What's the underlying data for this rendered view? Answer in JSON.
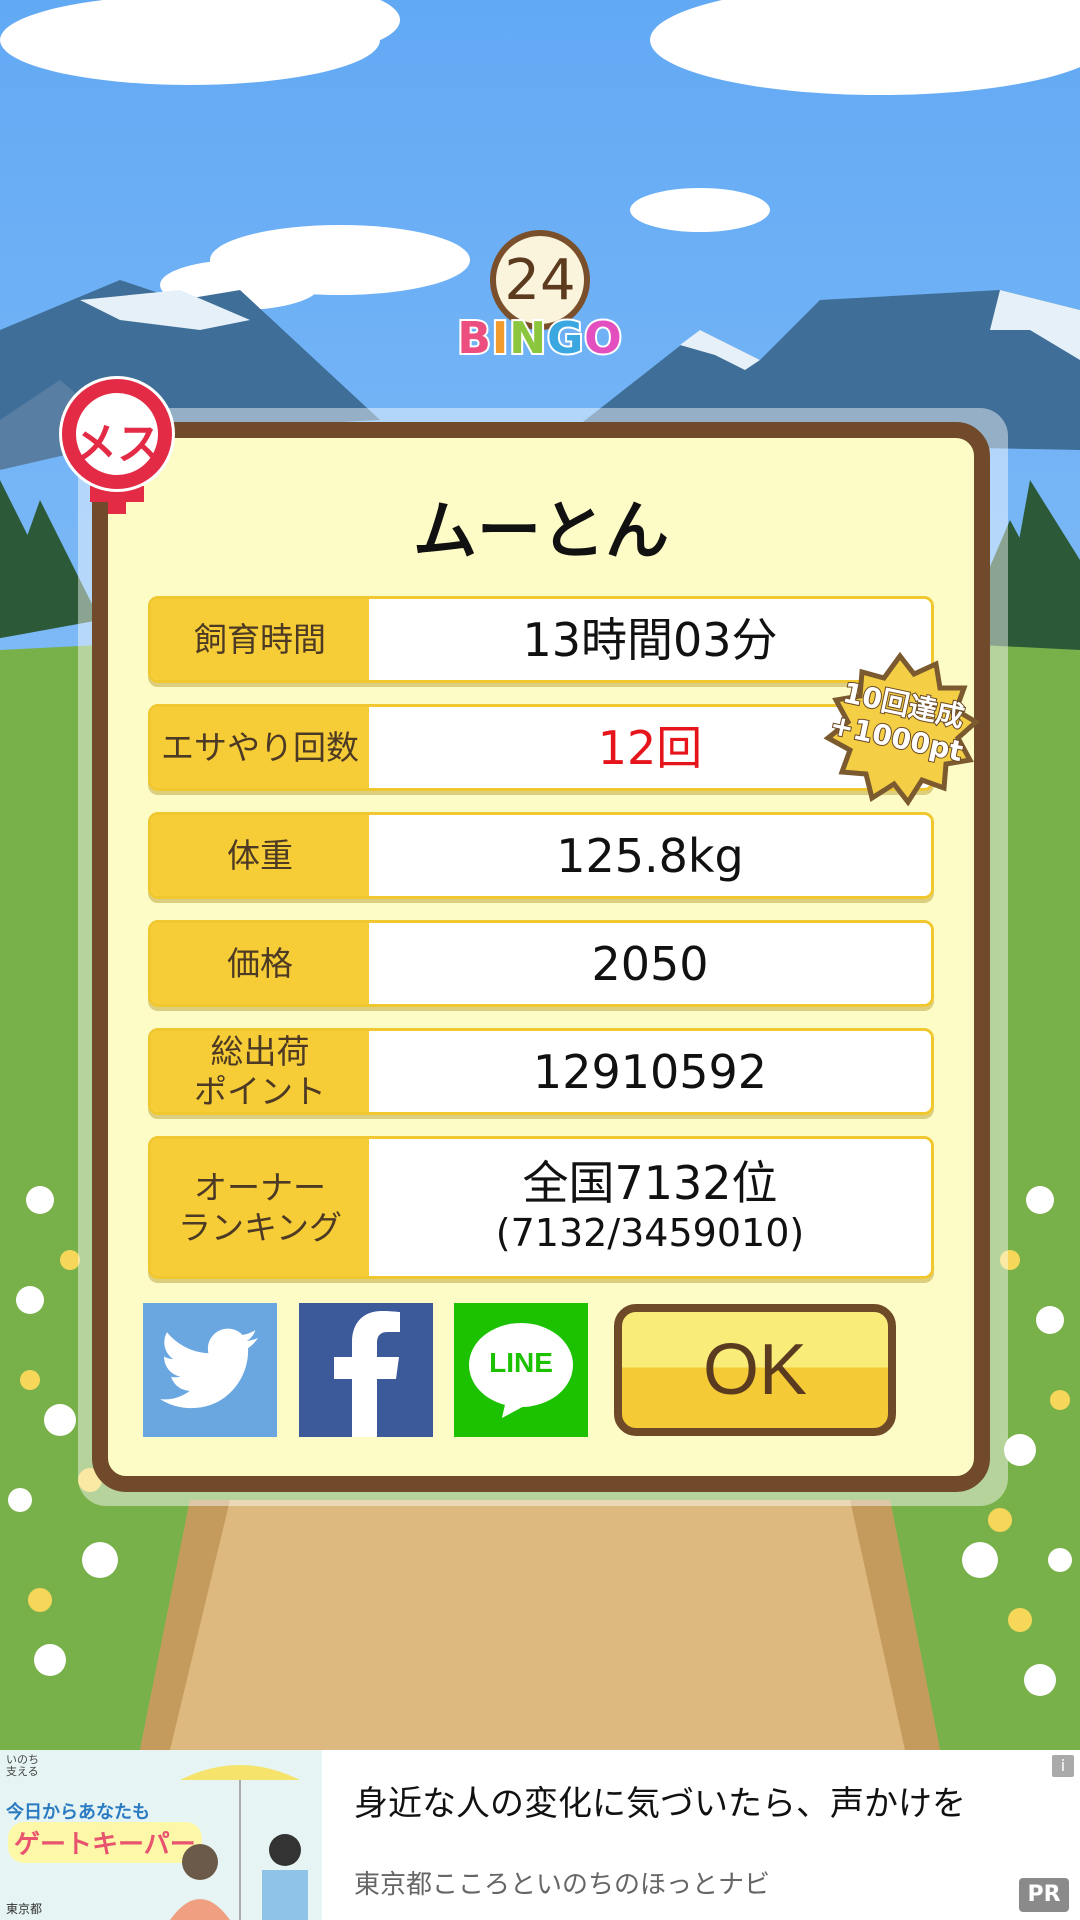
{
  "bingo": {
    "number": "24",
    "letters": [
      "B",
      "I",
      "N",
      "G",
      "O"
    ],
    "letter_colors": [
      "#ec4f7f",
      "#f39c2e",
      "#8cc63f",
      "#3aa7e0",
      "#e44fbf"
    ]
  },
  "gender": {
    "label": "メス",
    "color": "#e32b46"
  },
  "pig": {
    "name": "ムーとん"
  },
  "stats": {
    "rows": [
      {
        "label": "飼育時間",
        "value": "13時間03分"
      },
      {
        "label": "エサやり回数",
        "value": "12回"
      },
      {
        "label": "体重",
        "value": "125.8kg"
      },
      {
        "label": "価格",
        "value": "2050"
      },
      {
        "label": "総出荷\nポイント",
        "value": "12910592"
      },
      {
        "label": "オーナー\nランキング",
        "value": "全国7132位",
        "sub": "(7132/3459010)"
      }
    ]
  },
  "achievement": {
    "line1": "10回達成",
    "line2": "+1000pt"
  },
  "share": {
    "twitter_icon": "twitter-bird-icon",
    "facebook_icon": "facebook-f-icon",
    "line_label": "LINE"
  },
  "ok_button": {
    "label": "OK"
  },
  "ad": {
    "image_tag": "いのち\n支える",
    "image_line1": "今日からあなたも",
    "image_line2": "ゲートキーパー",
    "image_footer": "東京都",
    "title": "身近な人の変化に気づいたら、声かけを",
    "subtitle": "東京都こころといのちのほっとナビ",
    "info": "i",
    "pr": "PR"
  },
  "colors": {
    "panel_border": "#704a2a",
    "panel_fill": "#fdfcc6",
    "label_fill": "#f6cd36",
    "highlight_red": "#e5151b"
  }
}
